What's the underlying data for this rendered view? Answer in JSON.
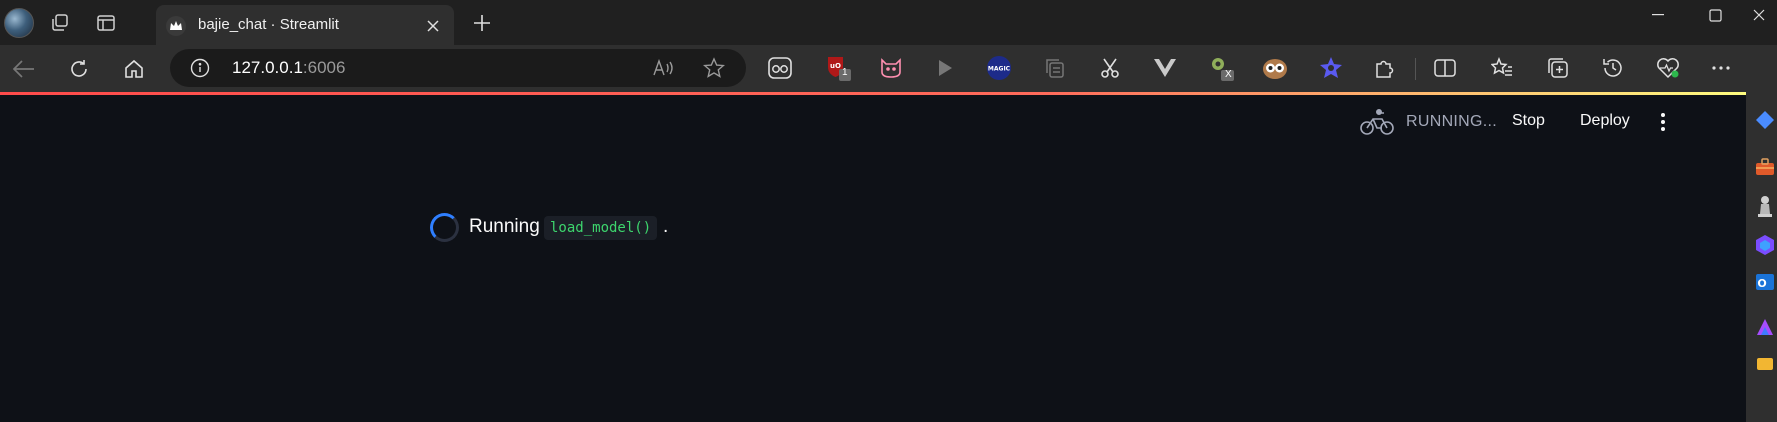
{
  "browser": {
    "tab": {
      "title": "bajie_chat · Streamlit"
    },
    "address": {
      "host": "127.0.0.1",
      "port": ":6006"
    },
    "icons": {
      "workspaces": "workspaces-icon",
      "tab_actions": "tab-actions-icon",
      "back": "back-arrow-icon",
      "refresh": "refresh-icon",
      "home": "home-icon",
      "site_info": "info-icon",
      "read_aloud": "read-aloud-icon",
      "favorite": "star-icon"
    },
    "extensions": {
      "ublock_badge": "1",
      "x_badge": "X"
    },
    "window_controls": [
      "minimize-icon",
      "maximize-icon",
      "close-icon"
    ]
  },
  "streamlit": {
    "status_label": "RUNNING...",
    "stop_label": "Stop",
    "deploy_label": "Deploy",
    "spinner_text": "Running",
    "spinner_code": "load_model()",
    "spinner_suffix": "."
  },
  "colors": {
    "page_bg": "#0e1117",
    "code_green": "#3dd56d",
    "spinner_blue": "#2f7fff",
    "loadbar_red": "#ff4b4b",
    "loadbar_yellow": "#fffd80"
  }
}
